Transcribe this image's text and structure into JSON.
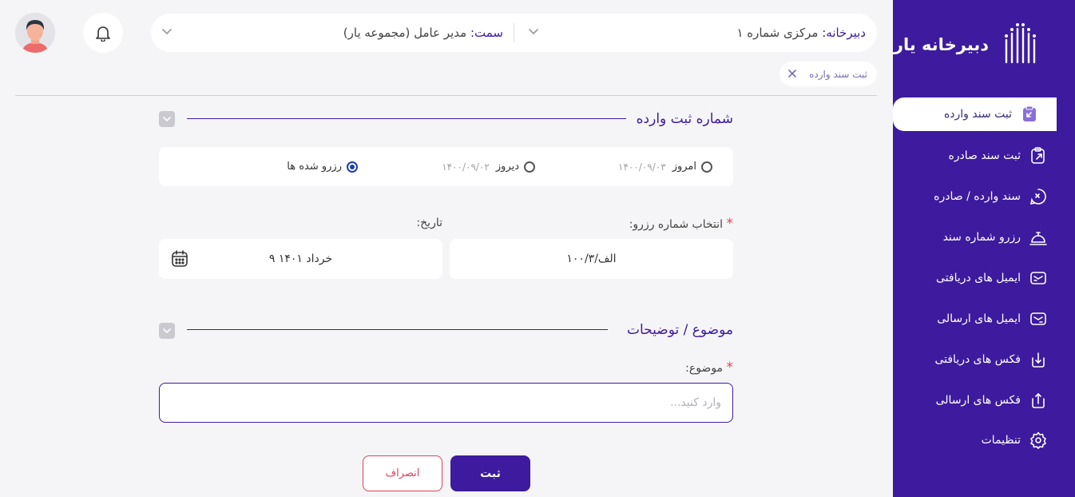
{
  "brand": {
    "name": "دبیرخانه یار",
    "logo_icon": "columns-logo-icon"
  },
  "sidebar": {
    "items": [
      {
        "label": "ثبت سند وارده",
        "icon": "incoming-doc-icon",
        "active": true
      },
      {
        "label": "ثبت سند صادره",
        "icon": "outgoing-doc-icon"
      },
      {
        "label": "سند وارده / صادره",
        "icon": "doc-exchange-icon"
      },
      {
        "label": "رزرو شماره سند",
        "icon": "reserve-bell-icon"
      },
      {
        "label": "ایمیل های دریافتی",
        "icon": "mail-in-icon"
      },
      {
        "label": "ایمیل های ارسالی",
        "icon": "mail-out-icon"
      },
      {
        "label": "فکس های دریافتی",
        "icon": "fax-in-icon"
      },
      {
        "label": "فکس های ارسالی",
        "icon": "fax-out-icon"
      },
      {
        "label": "تنظیمات",
        "icon": "gear-icon"
      }
    ]
  },
  "topbar": {
    "office_key": "دبیرخانه:",
    "office_value": "مرکزی شماره ۱",
    "role_key": "سمت:",
    "role_value": "مدیر عامل (مجموعه یار)"
  },
  "tab_chip": {
    "label": "ثبت سند وارده"
  },
  "section1": {
    "title": "شماره ثبت وارده",
    "radios": [
      {
        "label": "امروز",
        "date": "۱۴۰۰/۰۹/۰۳",
        "checked": false
      },
      {
        "label": "دیروز",
        "date": "۱۴۰۰/۰۹/۰۲",
        "checked": false
      },
      {
        "label": "رزرو شده ها",
        "date": "",
        "checked": true
      }
    ],
    "reserve_label": "انتخاب شماره رزرو:",
    "reserve_value": "۱۰۰/۳/الف",
    "date_label": "تاریخ:",
    "date_value": "۹ خرداد ۱۴۰۱"
  },
  "section2": {
    "title": "موضوع / توضیحات",
    "subject_label": "موضوع:",
    "subject_placeholder": "وارد کنید..."
  },
  "actions": {
    "submit": "ثبت",
    "cancel": "انصراف"
  },
  "colors": {
    "primary": "#3e1a9e",
    "danger": "#e0405a",
    "background": "#f5f5f7"
  }
}
